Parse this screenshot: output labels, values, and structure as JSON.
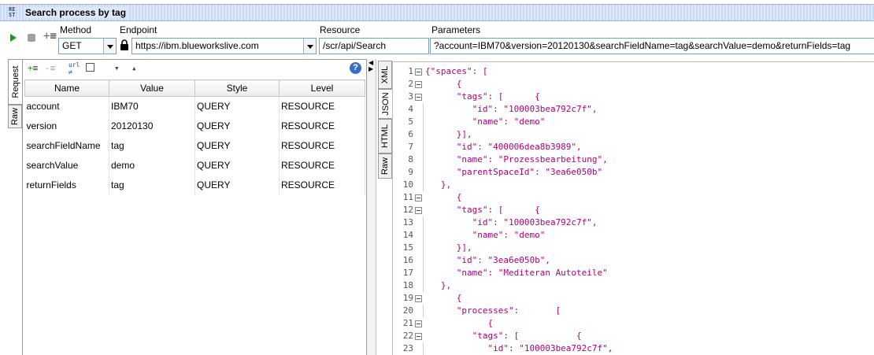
{
  "window": {
    "title": "Search process by tag",
    "icon": "rest-icon"
  },
  "toolbar": {
    "method_label": "Method",
    "method_value": "GET",
    "endpoint_label": "Endpoint",
    "endpoint_value": "https://ibm.blueworkslive.com",
    "resource_label": "Resource",
    "resource_value": "/scr/api/Search",
    "parameters_label": "Parameters",
    "parameters_value": "?account=IBM70&version=20120130&searchFieldName=tag&searchValue=demo&returnFields=tag"
  },
  "left_tabs": [
    "Request",
    "Raw"
  ],
  "right_tabs": [
    "XML",
    "JSON",
    "HTML",
    "Raw"
  ],
  "params_table": {
    "headers": [
      "Name",
      "Value",
      "Style",
      "Level"
    ],
    "rows": [
      [
        "account",
        "IBM70",
        "QUERY",
        "RESOURCE"
      ],
      [
        "version",
        "20120130",
        "QUERY",
        "RESOURCE"
      ],
      [
        "searchFieldName",
        "tag",
        "QUERY",
        "RESOURCE"
      ],
      [
        "searchValue",
        "demo",
        "QUERY",
        "RESOURCE"
      ],
      [
        "returnFields",
        "tag",
        "QUERY",
        "RESOURCE"
      ]
    ]
  },
  "code_lines": [
    {
      "n": "1",
      "fold": true,
      "text": "{\"spaces\": ["
    },
    {
      "n": "2",
      "fold": true,
      "text": "      {"
    },
    {
      "n": "3",
      "fold": true,
      "text": "      \"tags\": [      {"
    },
    {
      "n": "4",
      "fold": false,
      "text": "         \"id\": \"100003bea792c7f\","
    },
    {
      "n": "5",
      "fold": false,
      "text": "         \"name\": \"demo\""
    },
    {
      "n": "6",
      "fold": false,
      "text": "      }],"
    },
    {
      "n": "7",
      "fold": false,
      "text": "      \"id\": \"400006dea8b3989\","
    },
    {
      "n": "8",
      "fold": false,
      "text": "      \"name\": \"Prozessbearbeitung\","
    },
    {
      "n": "9",
      "fold": false,
      "text": "      \"parentSpaceId\": \"3ea6e050b\""
    },
    {
      "n": "10",
      "fold": false,
      "text": "   },"
    },
    {
      "n": "11",
      "fold": true,
      "text": "      {"
    },
    {
      "n": "12",
      "fold": true,
      "text": "      \"tags\": [      {"
    },
    {
      "n": "13",
      "fold": false,
      "text": "         \"id\": \"100003bea792c7f\","
    },
    {
      "n": "14",
      "fold": false,
      "text": "         \"name\": \"demo\""
    },
    {
      "n": "15",
      "fold": false,
      "text": "      }],"
    },
    {
      "n": "16",
      "fold": false,
      "text": "      \"id\": \"3ea6e050b\","
    },
    {
      "n": "17",
      "fold": false,
      "text": "      \"name\": \"Mediteran Autoteile\""
    },
    {
      "n": "18",
      "fold": false,
      "text": "   },"
    },
    {
      "n": "19",
      "fold": true,
      "text": "      {"
    },
    {
      "n": "20",
      "fold": false,
      "text": "      \"processes\":       ["
    },
    {
      "n": "21",
      "fold": true,
      "text": "            {"
    },
    {
      "n": "22",
      "fold": true,
      "text": "         \"tags\": [           {"
    },
    {
      "n": "23",
      "fold": false,
      "text": "            \"id\": \"100003bea792c7f\","
    }
  ]
}
